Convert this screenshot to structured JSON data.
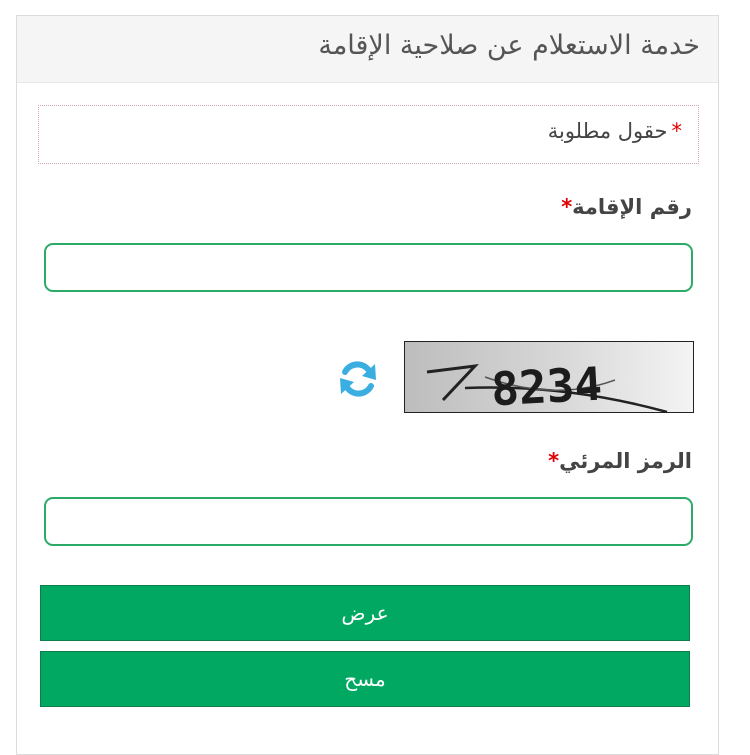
{
  "panel": {
    "title": "خدمة الاستعلام عن صلاحية الإقامة"
  },
  "required_note": {
    "star": "*",
    "text": "حقول مطلوبة"
  },
  "iqama_field": {
    "label": "رقم الإقامة",
    "star": "*",
    "value": ""
  },
  "captcha": {
    "text": "8234",
    "refresh_icon": "refresh-icon",
    "refresh_color": "#3aaee0"
  },
  "captcha_field": {
    "label": "الرمز المرئي",
    "star": "*",
    "value": ""
  },
  "buttons": {
    "submit_label": "عرض",
    "clear_label": "مسح",
    "color": "#00a862"
  }
}
